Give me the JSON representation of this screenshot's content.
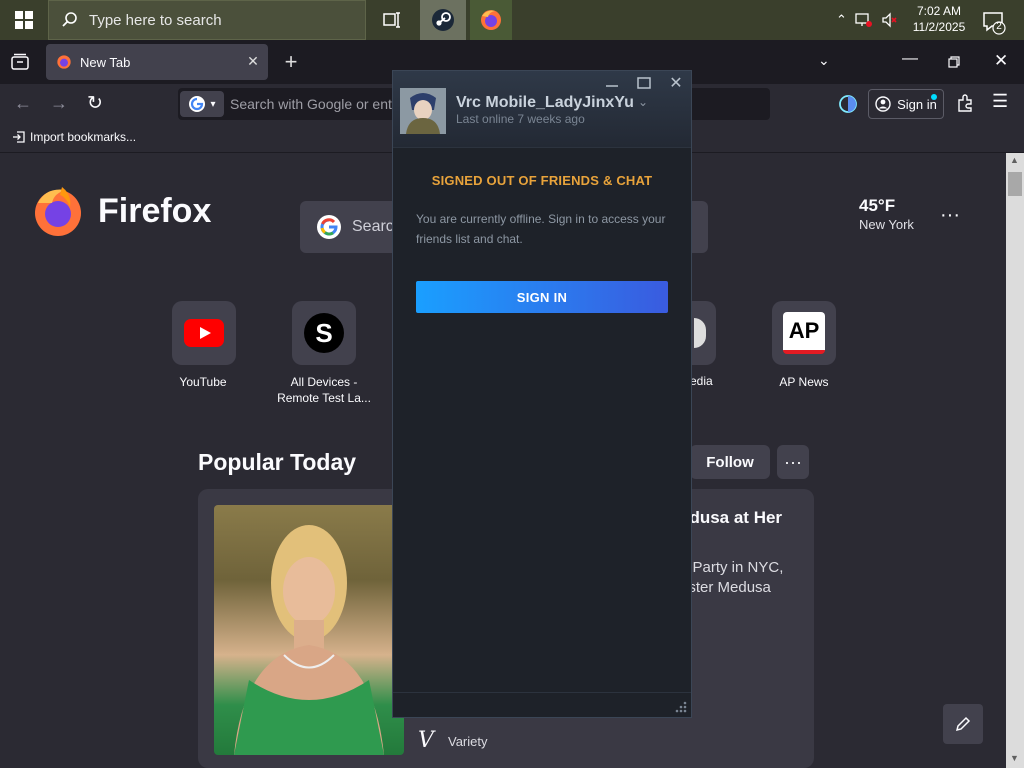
{
  "taskbar": {
    "search_placeholder": "Type here to search",
    "time": "7:02 AM",
    "date": "11/2/2025",
    "notifications_count": "2"
  },
  "browser": {
    "tab_title": "New Tab",
    "url_placeholder": "Search with Google or ente",
    "signin_label": "Sign in",
    "import_bookmarks": "Import bookmarks...",
    "brand": "Firefox",
    "big_search_placeholder": "Search",
    "weather": {
      "temp": "45°F",
      "city": "New York"
    },
    "shortcuts": [
      {
        "label": "YouTube"
      },
      {
        "label": "All Devices -",
        "label2": "Remote Test La..."
      },
      {
        "label": "edia"
      },
      {
        "label": "AP News"
      }
    ],
    "shortcut_glyphs": {
      "s": "S",
      "ap": "AP"
    },
    "popular_today": "Popular Today",
    "follow_label": "Follow",
    "more_label": "···",
    "card": {
      "title": "edusa at Her",
      "desc_line1": "n Party in NYC,",
      "desc_line2": "nster Medusa",
      "source_letter": "V",
      "source": "Variety"
    }
  },
  "steam": {
    "username": "Vrc Mobile_LadyJinxYu",
    "status": "Last online 7 weeks ago",
    "heading": "SIGNED OUT OF FRIENDS & CHAT",
    "message": "You are currently offline. Sign in to access your friends list and chat.",
    "signin_label": "SIGN IN"
  },
  "colors": {
    "accent_orange": "#e8a33b",
    "steam_blue_start": "#1a9fff",
    "steam_blue_end": "#3a5bdf",
    "browser_bg": "#2b2a33"
  }
}
